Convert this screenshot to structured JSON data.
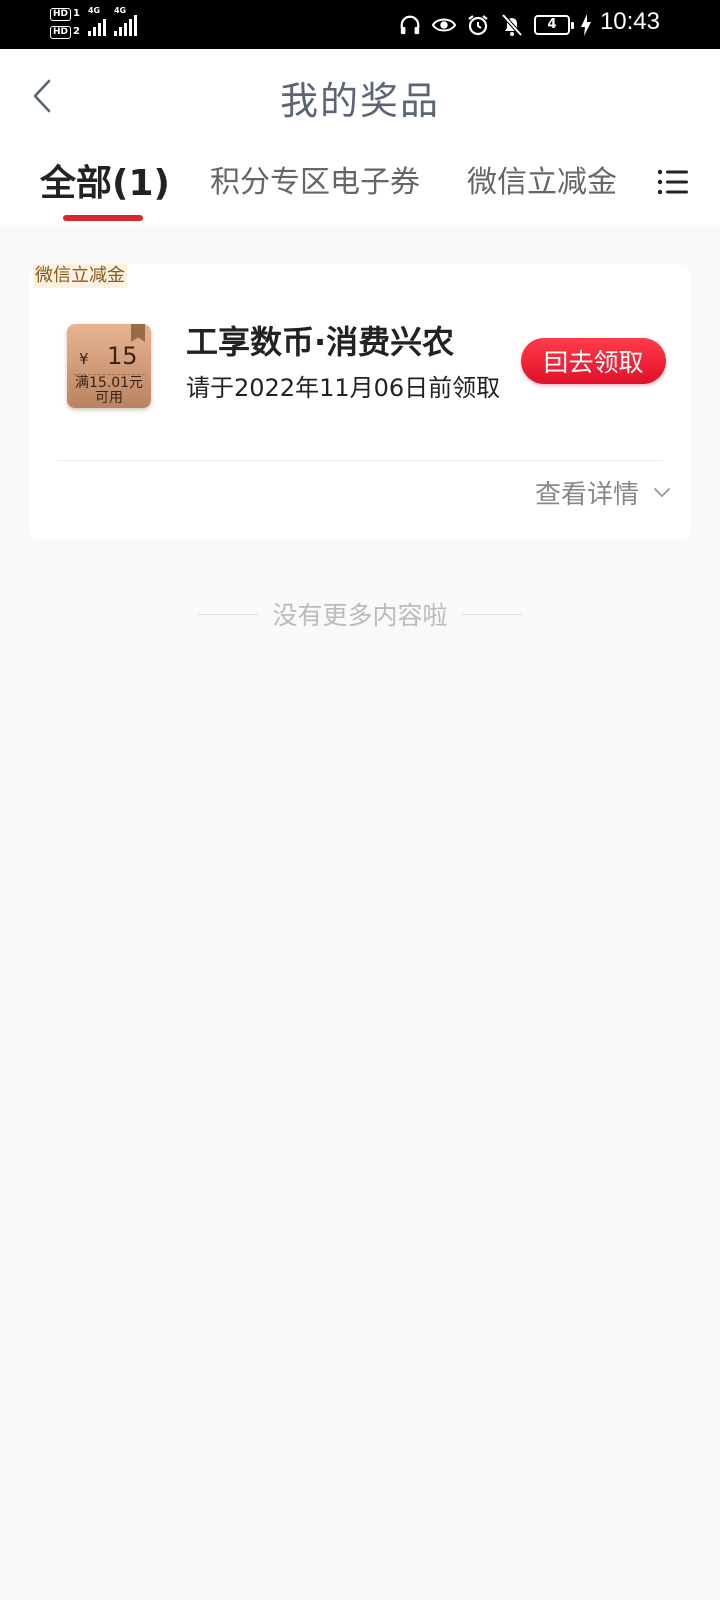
{
  "status_bar": {
    "hd1": "HD",
    "hd1_sim": "1",
    "hd2": "HD",
    "hd2_sim": "2",
    "net1": "4G",
    "net2": "4G",
    "battery": "4",
    "time": "10:43"
  },
  "header": {
    "title": "我的奖品"
  },
  "tabs": [
    {
      "label": "全部(1)",
      "active": true
    },
    {
      "label": "积分专区电子券",
      "active": false
    },
    {
      "label": "微信立减金",
      "active": false
    }
  ],
  "prize_card": {
    "tag": "微信立减金",
    "coupon": {
      "currency": "¥",
      "amount": "15",
      "condition_line1": "满15.01元",
      "condition_line2": "可用"
    },
    "name": "工享数币·消费兴农",
    "expire": "请于2022年11月06日前领取",
    "claim_button": "囙去领取",
    "detail_link": "查看详情"
  },
  "footer_note": "没有更多内容啦",
  "colors": {
    "accent_red": "#d6282f",
    "title_color": "#5a6678"
  }
}
